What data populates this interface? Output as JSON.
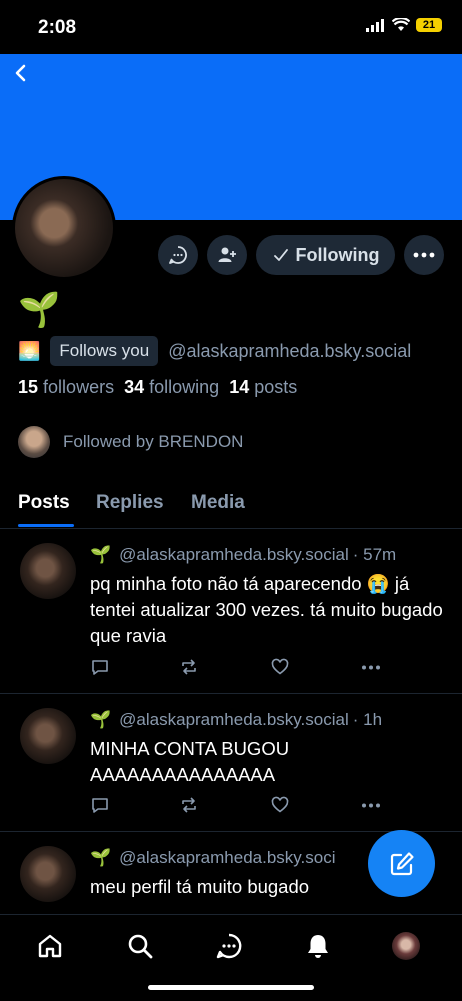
{
  "status_bar": {
    "time": "2:08",
    "battery": "21"
  },
  "profile": {
    "display_name": "🌱",
    "bio_emoji": "🌅",
    "follows_you": "Follows you",
    "handle": "@alaskapramheda.bsky.social",
    "followers_count": "15",
    "followers_label": "followers",
    "following_count": "34",
    "following_label": "following",
    "posts_count": "14",
    "posts_label": "posts",
    "followed_by": "Followed by BRENDON",
    "following_button": "Following"
  },
  "tabs": [
    "Posts",
    "Replies",
    "Media"
  ],
  "posts": [
    {
      "emoji": "🌱",
      "handle": "@alaskapramheda.bsky.social",
      "time": "· 57m",
      "text": "pq minha foto não tá aparecendo 😭 já tentei atualizar 300 vezes. tá muito bugado que ravia"
    },
    {
      "emoji": "🌱",
      "handle": "@alaskapramheda.bsky.social",
      "time": "· 1h",
      "text": "MINHA CONTA BUGOU AAAAAAAAAAAAAAA"
    },
    {
      "emoji": "🌱",
      "handle": "@alaskapramheda.bsky.soci",
      "time": "",
      "text": "meu perfil tá muito bugado"
    }
  ],
  "colors": {
    "accent": "#0a6df8",
    "fab": "#1583f5",
    "muted": "#8a9aae",
    "chip": "#1e2936"
  },
  "icons": [
    "back-icon",
    "chat-icon",
    "add-user-icon",
    "check-icon",
    "more-icon",
    "reply-icon",
    "repost-icon",
    "like-icon",
    "compose-icon",
    "home-icon",
    "search-icon",
    "messages-icon",
    "notifications-icon"
  ]
}
